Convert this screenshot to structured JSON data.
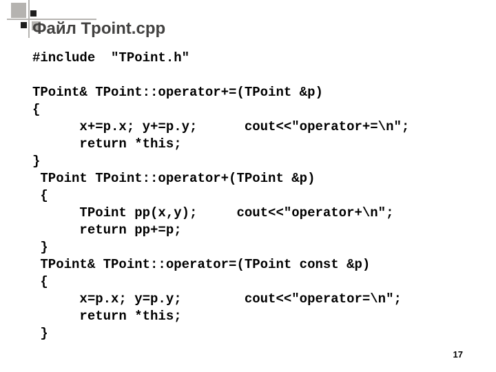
{
  "title": "Файл Tpoint.cpp",
  "page_number": "17",
  "code_lines": [
    "#include  \"TPoint.h\"",
    "",
    "TPoint& TPoint::operator+=(TPoint &p)",
    "{",
    "      x+=p.x; y+=p.y;      cout<<\"operator+=\\n\";",
    "      return *this;",
    "}",
    " TPoint TPoint::operator+(TPoint &p)",
    " {",
    "      TPoint pp(x,y);     cout<<\"operator+\\n\";",
    "      return pp+=p;",
    " }",
    " TPoint& TPoint::operator=(TPoint const &p)",
    " {",
    "      x=p.x; y=p.y;        cout<<\"operator=\\n\";",
    "      return *this;",
    " }"
  ]
}
